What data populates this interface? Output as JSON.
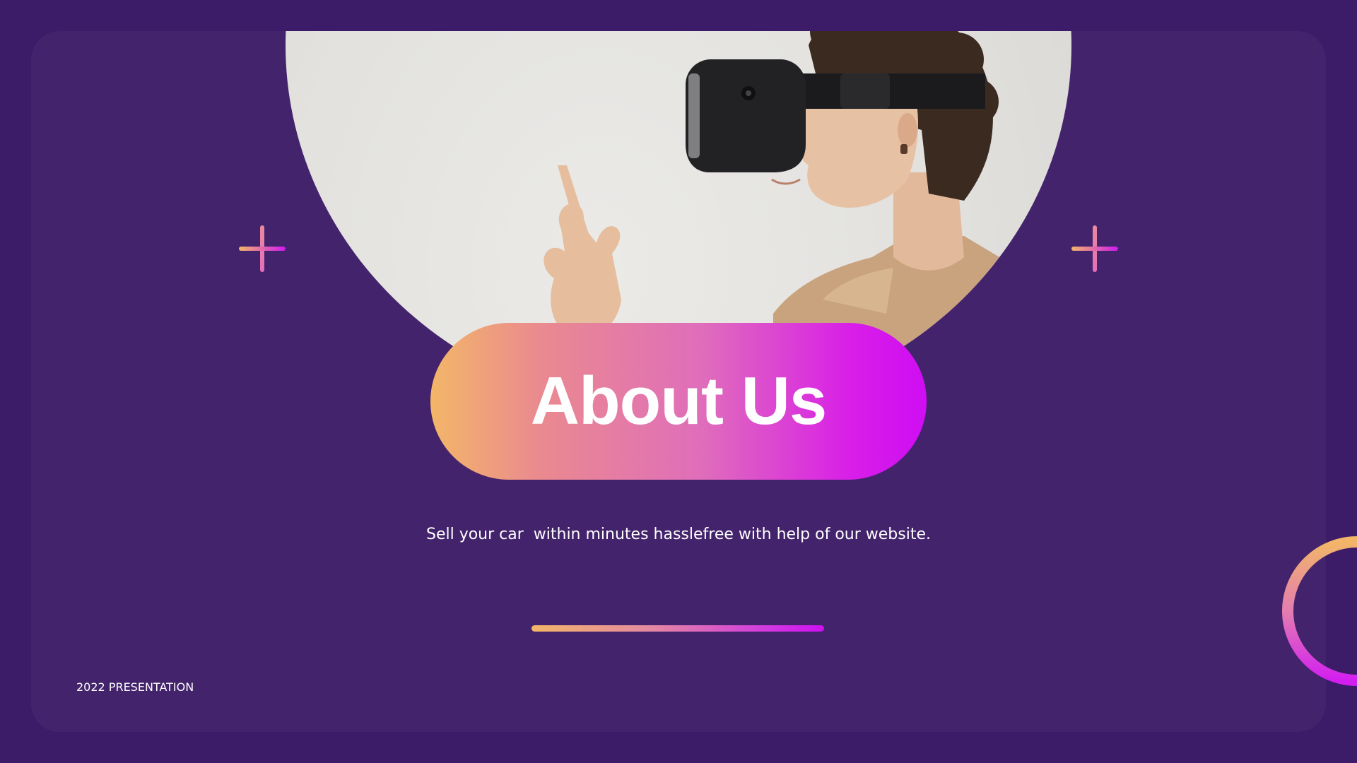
{
  "slide": {
    "title": "About Us",
    "subtitle": "Sell your car  within minutes hasslefree with help of our website.",
    "footer": "2022 PRESENTATION"
  },
  "photo": {
    "subject": "person wearing VR headset"
  },
  "icons": {
    "decor_left": "plus-icon",
    "decor_right": "plus-icon",
    "decor_corner": "ring-icon"
  },
  "colors": {
    "background": "#3c1b68",
    "card": "#43236b",
    "gradient_start": "#f3b668",
    "gradient_mid": "#df6dbb",
    "gradient_end": "#cf0df3",
    "text": "#ffffff"
  }
}
